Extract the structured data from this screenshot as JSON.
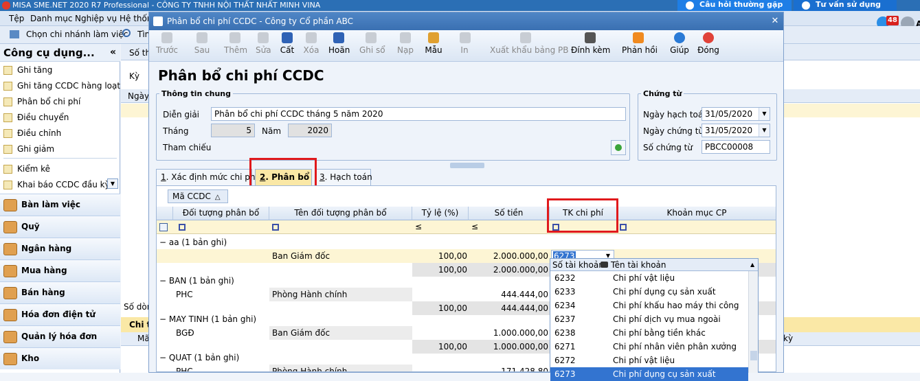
{
  "app": {
    "title": "MISA SME.NET 2020 R7 Professional - CÔNG TY TNHH NỘI THẤT NHẤT MINH VINA",
    "help1": "Câu hỏi thường gặp",
    "help2": "Tư vấn sử dụng",
    "badge": "48",
    "letter": "A"
  },
  "menu": [
    "Tệp",
    "Danh mục",
    "Nghiệp vụ",
    "Hệ thốn"
  ],
  "topbar": {
    "branch": "Chọn chi nhánh làm việc",
    "search": "Tìm"
  },
  "left": {
    "title": "Công cụ dụng...",
    "collapse": "«",
    "items": [
      "Ghi tăng",
      "Ghi tăng CCDC hàng loạt",
      "Phân bổ chi phí",
      "Điều chuyển",
      "Điều chỉnh",
      "Ghi giảm",
      "Kiểm kê",
      "Khai báo CCDC đầu kỳ"
    ],
    "groups": [
      "Bàn làm việc",
      "Quỹ",
      "Ngân hàng",
      "Mua hàng",
      "Bán hàng",
      "Hóa đơn điện tử",
      "Quản lý hóa đơn",
      "Kho"
    ]
  },
  "bg": {
    "so_the": "Số thẻ",
    "ky": "Kỳ",
    "ngay": "Ngày",
    "so_dong": "Số dòng",
    "chi_ti": "Chi ti",
    "ma": "Mã",
    "ky2": "kỳ"
  },
  "dialog": {
    "title": "Phân bổ chi phí CCDC - Công ty Cổ phần ABC",
    "toolbar": [
      {
        "label": "Trước",
        "enabled": false,
        "icon": "arrow-left-icon"
      },
      {
        "label": "Sau",
        "enabled": false,
        "icon": "arrow-right-icon"
      },
      {
        "label": "Thêm",
        "enabled": false,
        "icon": "add-icon"
      },
      {
        "label": "Sửa",
        "enabled": false,
        "icon": "edit-icon"
      },
      {
        "label": "Cất",
        "enabled": true,
        "icon": "save-icon"
      },
      {
        "label": "Xóa",
        "enabled": false,
        "icon": "delete-icon"
      },
      {
        "label": "Hoãn",
        "enabled": true,
        "icon": "undo-icon"
      },
      {
        "label": "Ghi sổ",
        "enabled": false,
        "icon": "post-icon"
      },
      {
        "label": "Nạp",
        "enabled": false,
        "icon": "reload-icon"
      },
      {
        "label": "Mẫu",
        "enabled": true,
        "icon": "template-icon"
      },
      {
        "label": "In",
        "enabled": false,
        "icon": "print-icon"
      },
      {
        "label": "Xuất khẩu bảng PB",
        "enabled": false,
        "icon": "export-icon"
      },
      {
        "label": "Đính kèm",
        "enabled": true,
        "icon": "attach-icon"
      },
      {
        "label": "Phản hồi",
        "enabled": true,
        "icon": "feedback-icon"
      },
      {
        "label": "Giúp",
        "enabled": true,
        "icon": "help-icon"
      },
      {
        "label": "Đóng",
        "enabled": true,
        "icon": "close-icon"
      }
    ],
    "page_title": "Phân bổ chi phí CCDC",
    "general": {
      "legend": "Thông tin chung",
      "dien_giai_label": "Diễn giải",
      "dien_giai": "Phân bổ chi phí CCDC tháng 5 năm 2020",
      "thang_label": "Tháng",
      "thang": "5",
      "nam_label": "Năm",
      "nam": "2020",
      "tham_chieu_label": "Tham chiếu"
    },
    "voucher": {
      "legend": "Chứng từ",
      "ngay_hach_toan_label": "Ngày hạch toán",
      "ngay_hach_toan": "31/05/2020",
      "ngay_chung_tu_label": "Ngày chứng từ",
      "ngay_chung_tu": "31/05/2020",
      "so_chung_tu_label": "Số chứng từ",
      "so_chung_tu": "PBCC00008"
    },
    "tabs": [
      {
        "num": "1",
        "label": ". Xác định mức chi phí"
      },
      {
        "num": "2",
        "label": ". Phân bổ"
      },
      {
        "num": "3",
        "label": ". Hạch toán"
      }
    ],
    "group_by": "Mã CCDC",
    "columns": [
      "Đối tượng phân bổ",
      "Tên đối tượng phân bổ",
      "Tỷ lệ (%)",
      "Số tiền",
      "TK chi phí",
      "Khoản mục CP"
    ],
    "filter_ops": [
      "≤",
      "≤"
    ],
    "groups": [
      {
        "header": "aa (1 bản ghi)",
        "code": "",
        "name": "Ban Giám đốc",
        "rate": "100,00",
        "amount": "2.000.000,00",
        "tk": "6273",
        "sum_rate": "100,00",
        "sum_amount": "2.000.000,00"
      },
      {
        "header": "BAN (1 bản ghi)",
        "code": "PHC",
        "name": "Phòng Hành chính",
        "rate": "",
        "amount": "444.444,00",
        "tk": "",
        "sum_rate": "100,00",
        "sum_amount": "444.444,00"
      },
      {
        "header": "MAY TINH (1 bản ghi)",
        "code": "BGĐ",
        "name": "Ban Giám đốc",
        "rate": "",
        "amount": "1.000.000,00",
        "tk": "",
        "sum_rate": "100,00",
        "sum_amount": "1.000.000,00"
      },
      {
        "header": "QUAT (1 bản ghi)",
        "code": "PHC",
        "name": "Phòng Hành chính",
        "rate": "",
        "amount": "171.428,80",
        "tk": "",
        "sum_rate": "",
        "sum_amount": ""
      }
    ],
    "popup": {
      "col1": "Số tài khoản",
      "col2": "Tên tài khoản",
      "rows": [
        {
          "code": "6232",
          "name": "Chi phí vật liệu"
        },
        {
          "code": "6233",
          "name": "Chi phí dụng cụ sản xuất"
        },
        {
          "code": "6234",
          "name": "Chi phí khấu hao máy thi công"
        },
        {
          "code": "6237",
          "name": "Chi phí dịch vụ mua ngoài"
        },
        {
          "code": "6238",
          "name": "Chi phí bằng tiền khác"
        },
        {
          "code": "6271",
          "name": "Chi phí nhân viên phân xưởng"
        },
        {
          "code": "6272",
          "name": "Chi phí vật liệu"
        },
        {
          "code": "6273",
          "name": "Chi phí dụng cụ sản xuất"
        }
      ]
    }
  },
  "colors": {
    "accent": "#2b6fb5",
    "highlight": "#e0191c",
    "active_tab": "#fae8a6",
    "filter_row": "#fdf5d4"
  }
}
